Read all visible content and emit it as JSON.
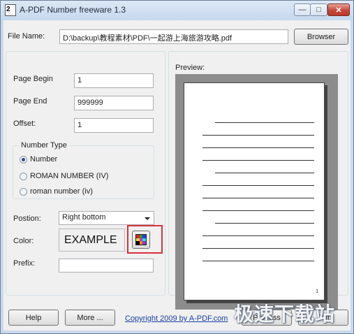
{
  "window": {
    "title": "A-PDF Number freeware 1.3",
    "app_icon_glyph": "2",
    "controls": {
      "minimize": "—",
      "maximize": "□",
      "close": "✕"
    }
  },
  "file": {
    "label": "File Name:",
    "value": "D:\\backup\\教程素材\\PDF\\一起游上海旅游攻略.pdf",
    "browse_label": "Browser"
  },
  "settings": {
    "page_begin_label": "Page Begin",
    "page_begin_value": "1",
    "page_end_label": "Page End",
    "page_end_value": "999999",
    "offset_label": "Offset:",
    "offset_value": "1",
    "number_type": {
      "title": "Number Type",
      "options": [
        {
          "label": "Number",
          "selected": true
        },
        {
          "label": "ROMAN NUMBER (IV)",
          "selected": false
        },
        {
          "label": "roman number (iv)",
          "selected": false
        }
      ]
    },
    "position_label": "Postion:",
    "position_value": "Right bottom",
    "color_label": "Color:",
    "color_example": "EXAMPLE",
    "prefix_label": "Prefix:",
    "prefix_value": ""
  },
  "preview": {
    "label": "Preview:",
    "page_number": "1"
  },
  "footer": {
    "help_label": "Help",
    "more_label": "More ...",
    "copyright_link": "Copyright 2009 by A-PDF.com",
    "process_label": "Process",
    "exit_label": "Exit"
  },
  "watermark": "极速下载站",
  "colors": {
    "titlebar": "#c9d9ec",
    "close_button": "#c8483a",
    "highlight_box": "#d9313c",
    "link": "#1a3ea8",
    "palette": [
      "#e02020",
      "#20a020",
      "#2040e0",
      "#e0e020",
      "#e020e0",
      "#20e0e0",
      "#000000",
      "#ff8000",
      "#8040c0"
    ]
  }
}
